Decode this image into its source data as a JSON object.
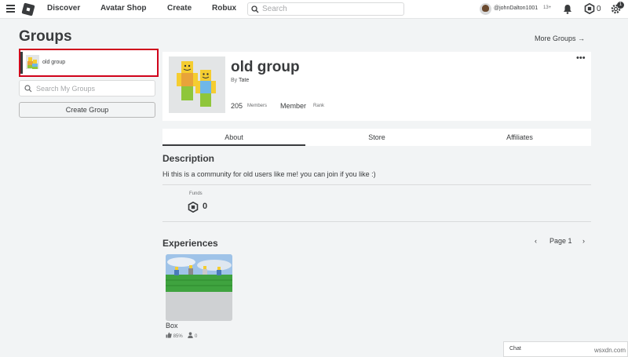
{
  "nav": {
    "links": [
      "Discover",
      "Avatar Shop",
      "Create",
      "Robux"
    ],
    "search_placeholder": "Search",
    "username": "@johnDalton1001",
    "age_badge": "13+",
    "robux_count": "0",
    "notification_count": "1"
  },
  "sidebar": {
    "title": "Groups",
    "selected_group": "old group",
    "search_placeholder": "Search My Groups",
    "create_label": "Create Group"
  },
  "header": {
    "more_groups": "More Groups →",
    "group_name": "old group",
    "by_label": "By",
    "owner": "Tate",
    "members_count": "205",
    "members_label": "Members",
    "rank_value": "Member",
    "rank_label": "Rank",
    "more_options": "•••"
  },
  "tabs": [
    "About",
    "Store",
    "Affiliates"
  ],
  "about": {
    "description_title": "Description",
    "description": "Hi this is a community for old users like me! you can join if you like :)",
    "funds_label": "Funds",
    "funds_value": "0"
  },
  "experiences": {
    "title": "Experiences",
    "page_label": "Page 1",
    "items": [
      {
        "name": "Box",
        "rating": "85%",
        "players": "0"
      }
    ]
  },
  "chat": {
    "label": "Chat"
  },
  "watermark": "wsxdn.com"
}
